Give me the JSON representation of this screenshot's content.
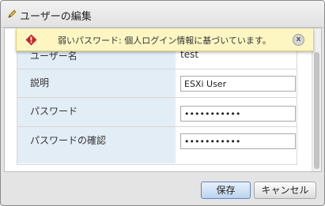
{
  "dialog": {
    "title": "ユーザーの編集",
    "title_icon": "pencil-icon"
  },
  "warning": {
    "text": "弱いパスワード: 個人ログイン情報に基づいています。",
    "icon": "warning-icon",
    "close_icon": "close-icon",
    "close_glyph": "x",
    "color": "#fdf6c3"
  },
  "form": {
    "username": {
      "label": "ユーザー名",
      "value": "test"
    },
    "description": {
      "label": "説明",
      "value": "ESXi User"
    },
    "password": {
      "label": "パスワード",
      "value": "•••••••••••"
    },
    "confirm": {
      "label": "パスワードの確認",
      "value": "•••••••••••"
    }
  },
  "buttons": {
    "save": "保存",
    "cancel": "キャンセル"
  }
}
